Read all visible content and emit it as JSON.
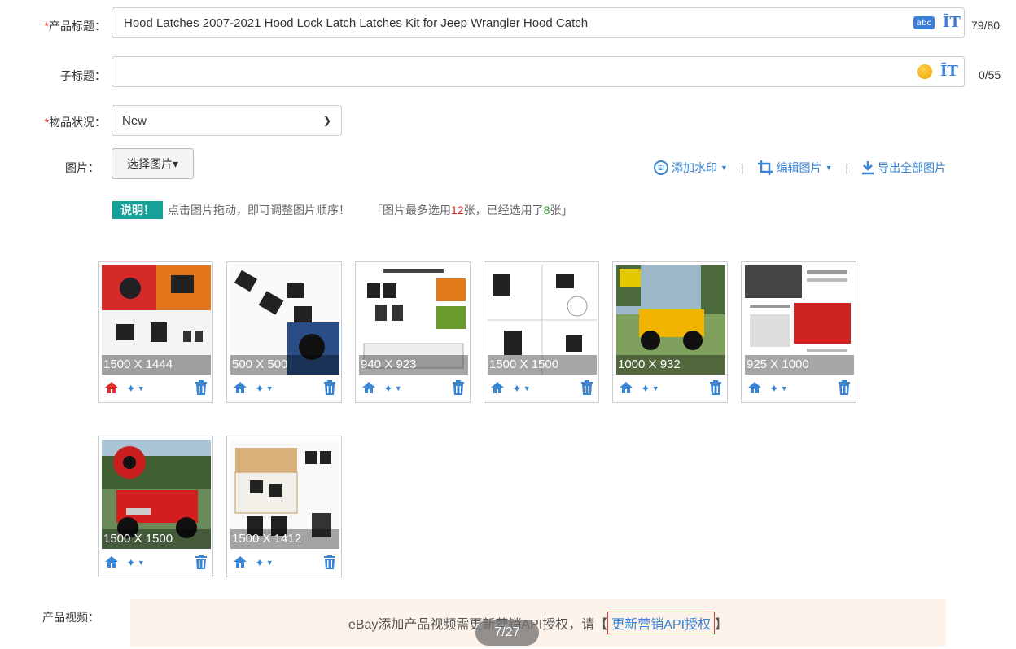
{
  "title_field": {
    "label": "产品标题：",
    "required_mark": "*",
    "value": "Hood Latches 2007-2021 Hood Lock Latch Latches Kit for Jeep Wrangler Hood Catch",
    "counter": "79/80",
    "icons": [
      "abc-icon",
      "text-size-icon"
    ]
  },
  "subtitle_field": {
    "label": "子标题：",
    "value": "",
    "counter": "0/55",
    "icons": [
      "coin-icon",
      "text-size-icon"
    ]
  },
  "condition_field": {
    "label": "物品状况：",
    "required_mark": "*",
    "selected": "New"
  },
  "images": {
    "label": "图片：",
    "choose_button": "选择图片▾",
    "toolbar": {
      "watermark": "添加水印",
      "edit": "编辑图片",
      "export": "导出全部图片",
      "separator": "|"
    },
    "note": {
      "badge": "说明！",
      "text": "点击图片拖动，即可调整图片顺序！",
      "limit_prefix": "「图片最多选用",
      "max": "12",
      "limit_mid": "张，已经选用了",
      "used": "8",
      "limit_suffix": "张」"
    },
    "thumbs": [
      {
        "size": "1500 X 1444",
        "main": true,
        "scene": "red-orange"
      },
      {
        "size": "500 X 500",
        "main": false,
        "scene": "white-blue"
      },
      {
        "size": "940 X 923",
        "main": false,
        "scene": "params"
      },
      {
        "size": "1500 X 1500",
        "main": false,
        "scene": "white-grid"
      },
      {
        "size": "1000 X 932",
        "main": false,
        "scene": "yellow-jeep"
      },
      {
        "size": "925 X 1000",
        "main": false,
        "scene": "doc-red"
      },
      {
        "size": "1500 X 1500",
        "main": false,
        "scene": "red-jeep"
      },
      {
        "size": "1500 X 1412",
        "main": false,
        "scene": "box"
      }
    ]
  },
  "video": {
    "label": "产品视频：",
    "message": "eBay添加产品视频需更新营销API授权，请【",
    "link": "更新营销API授权",
    "close": "】"
  },
  "pager": "7/27",
  "colors": {
    "accent": "#3a84d4",
    "required": "#e33333",
    "badge": "#15a09a"
  }
}
